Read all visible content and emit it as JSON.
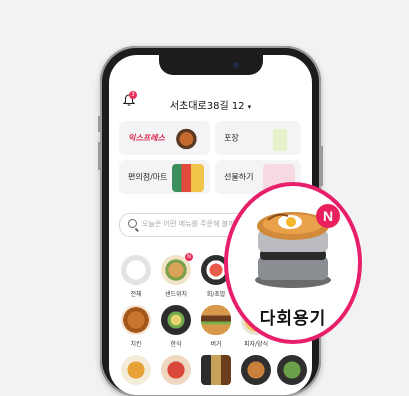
{
  "header": {
    "address": "서초대로38길 12",
    "dropdown_glyph": "▾",
    "bell_badge": "3"
  },
  "service_cards": [
    {
      "label": "익스프레스",
      "brand": true,
      "accent": "#d8284f"
    },
    {
      "label": "포장",
      "brand": false
    },
    {
      "label": "편의점/마트",
      "brand": false
    },
    {
      "label": "선물하기",
      "brand": false
    }
  ],
  "search": {
    "placeholder": "오늘은 어떤 메뉴를 주문해 볼까요?"
  },
  "categories_row1": [
    {
      "label": "전체",
      "badge": ""
    },
    {
      "label": "샌드위치",
      "badge": "N"
    },
    {
      "label": "회/초밥",
      "badge": "N"
    }
  ],
  "categories_row2": [
    {
      "label": "치킨"
    },
    {
      "label": "한식"
    },
    {
      "label": "버거"
    },
    {
      "label": "피자/양식"
    }
  ],
  "zoom_callout": {
    "badge": "N",
    "label": "다회용기",
    "ring_color": "#e8206b"
  },
  "icons": [
    "bell-icon",
    "search-icon",
    "chevron-down-icon"
  ]
}
